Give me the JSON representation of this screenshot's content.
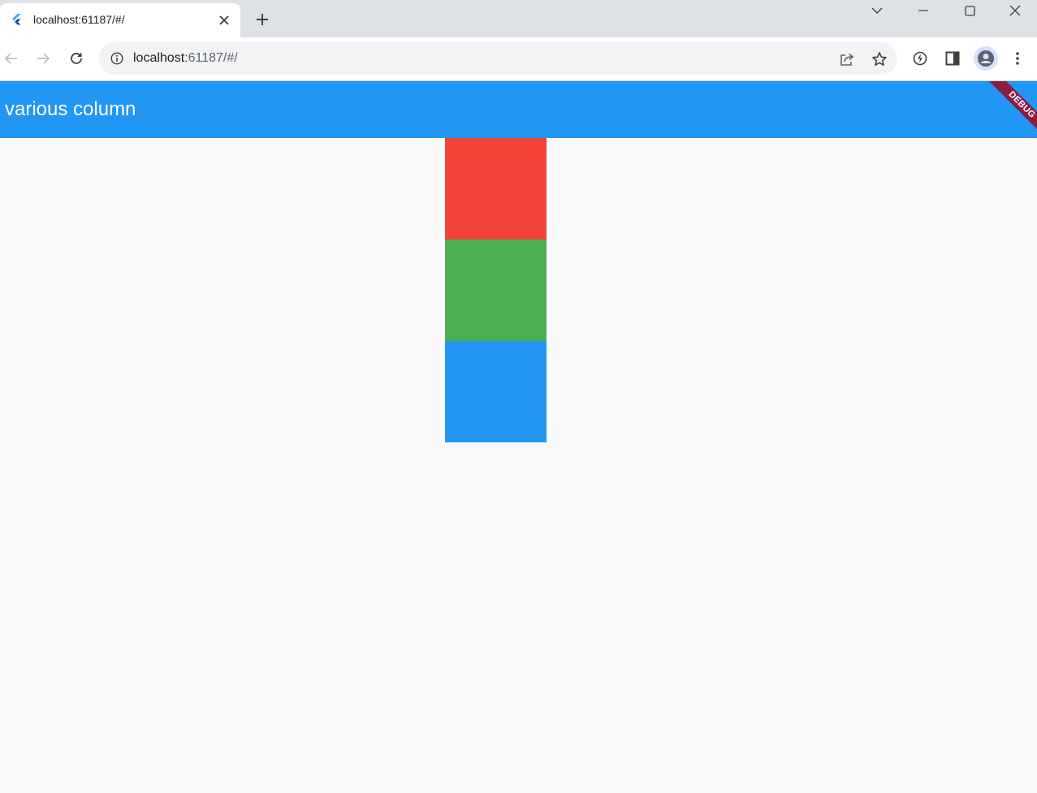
{
  "browser": {
    "tab_title": "localhost:61187/#/",
    "url_host": "localhost",
    "url_rest": ":61187/#/"
  },
  "app": {
    "title": "various column",
    "debug_label": "DEBUG",
    "colors": {
      "appbar": "#2196f3",
      "background": "#fafafa",
      "debug_banner": "#8b1d41"
    }
  },
  "column": {
    "boxes": [
      {
        "name": "red-box",
        "color": "#f44336"
      },
      {
        "name": "green-box",
        "color": "#4caf50"
      },
      {
        "name": "blue-box",
        "color": "#2196f3"
      }
    ]
  }
}
